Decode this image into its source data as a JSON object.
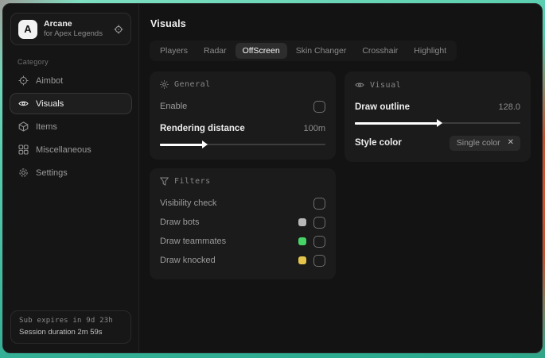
{
  "sidebar": {
    "logo_letter": "A",
    "title": "Arcane",
    "subtitle": "for Apex Legends",
    "category_label": "Category",
    "items": [
      {
        "label": "Aimbot",
        "icon": "crosshair-icon",
        "active": false
      },
      {
        "label": "Visuals",
        "icon": "eye-icon",
        "active": true
      },
      {
        "label": "Items",
        "icon": "cube-icon",
        "active": false
      },
      {
        "label": "Miscellaneous",
        "icon": "grid-icon",
        "active": false
      },
      {
        "label": "Settings",
        "icon": "gear-icon",
        "active": false
      }
    ],
    "footer": {
      "sub_expires": "Sub expires in 9d 23h",
      "session_duration": "Session duration 2m 59s"
    }
  },
  "main": {
    "title": "Visuals",
    "tabs": [
      {
        "label": "Players",
        "active": false
      },
      {
        "label": "Radar",
        "active": false
      },
      {
        "label": "OffScreen",
        "active": true
      },
      {
        "label": "Skin Changer",
        "active": false
      },
      {
        "label": "Crosshair",
        "active": false
      },
      {
        "label": "Highlight",
        "active": false
      }
    ],
    "panels": {
      "general": {
        "title": "General",
        "enable_label": "Enable",
        "enable_checked": false,
        "rendering_distance_label": "Rendering distance",
        "rendering_distance_value": "100m",
        "rendering_distance_fill": "26%"
      },
      "visual": {
        "title": "Visual",
        "draw_outline_label": "Draw outline",
        "draw_outline_value": "128.0",
        "draw_outline_fill": "50%",
        "style_color_label": "Style color",
        "style_color_selected": "Single color",
        "style_color_clear": "✕"
      },
      "filters": {
        "title": "Filters",
        "rows": [
          {
            "label": "Visibility check",
            "swatch": null,
            "checked": false
          },
          {
            "label": "Draw bots",
            "swatch": "#b8b8b8",
            "checked": false
          },
          {
            "label": "Draw teammates",
            "swatch": "#46d467",
            "checked": false
          },
          {
            "label": "Draw knocked",
            "swatch": "#e5c44c",
            "checked": false
          }
        ]
      }
    }
  },
  "colors": {
    "accent_green": "#46d467",
    "accent_yellow": "#e5c44c",
    "swatch_gray": "#b8b8b8",
    "desktop_teal": "#35b096",
    "desktop_orange": "#c34f2e"
  }
}
